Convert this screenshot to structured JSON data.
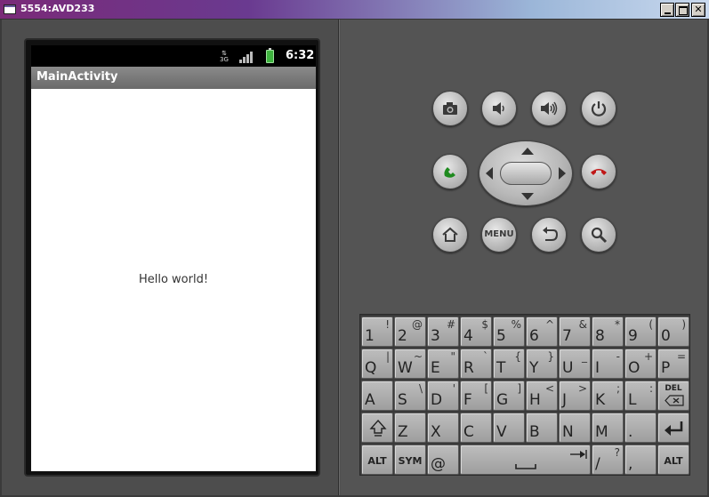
{
  "window": {
    "title": "5554:AVD233"
  },
  "device": {
    "status_time": "6:32",
    "status_data_label": "3G",
    "app_title": "MainActivity",
    "content_text": "Hello world!"
  },
  "controls": {
    "menu_label": "MENU",
    "icons": [
      "camera-icon",
      "volume-down-icon",
      "volume-up-icon",
      "power-icon",
      "call-icon",
      "end-call-icon",
      "home-icon",
      "back-icon",
      "search-icon"
    ]
  },
  "keyboard": {
    "row1": [
      {
        "main": "1",
        "alt": "!"
      },
      {
        "main": "2",
        "alt": "@"
      },
      {
        "main": "3",
        "alt": "#"
      },
      {
        "main": "4",
        "alt": "$"
      },
      {
        "main": "5",
        "alt": "%"
      },
      {
        "main": "6",
        "alt": "^"
      },
      {
        "main": "7",
        "alt": "&"
      },
      {
        "main": "8",
        "alt": "*"
      },
      {
        "main": "9",
        "alt": "("
      },
      {
        "main": "0",
        "alt": ")"
      }
    ],
    "row2": [
      {
        "main": "Q",
        "alt": "|"
      },
      {
        "main": "W",
        "alt": "~"
      },
      {
        "main": "E",
        "alt": "\""
      },
      {
        "main": "R",
        "alt": "`"
      },
      {
        "main": "T",
        "alt": "{"
      },
      {
        "main": "Y",
        "alt": "}"
      },
      {
        "main": "U",
        "alt": "_"
      },
      {
        "main": "I",
        "alt": "-"
      },
      {
        "main": "O",
        "alt": "+"
      },
      {
        "main": "P",
        "alt": "="
      }
    ],
    "row3": [
      {
        "main": "A",
        "alt": ""
      },
      {
        "main": "S",
        "alt": "\\"
      },
      {
        "main": "D",
        "alt": "'"
      },
      {
        "main": "F",
        "alt": "["
      },
      {
        "main": "G",
        "alt": "]"
      },
      {
        "main": "H",
        "alt": "<"
      },
      {
        "main": "J",
        "alt": ">"
      },
      {
        "main": "K",
        "alt": ";"
      },
      {
        "main": "L",
        "alt": ":"
      }
    ],
    "del_label": "DEL",
    "row4": [
      {
        "main": "Z",
        "alt": ""
      },
      {
        "main": "X",
        "alt": ""
      },
      {
        "main": "C",
        "alt": ""
      },
      {
        "main": "V",
        "alt": ""
      },
      {
        "main": "B",
        "alt": ""
      },
      {
        "main": "N",
        "alt": ""
      },
      {
        "main": "M",
        "alt": ""
      },
      {
        "main": ".",
        "alt": ""
      }
    ],
    "alt_label": "ALT",
    "sym_label": "SYM",
    "at_label": "@",
    "slash_main": "/",
    "slash_alt": "?",
    "comma_label": ","
  }
}
